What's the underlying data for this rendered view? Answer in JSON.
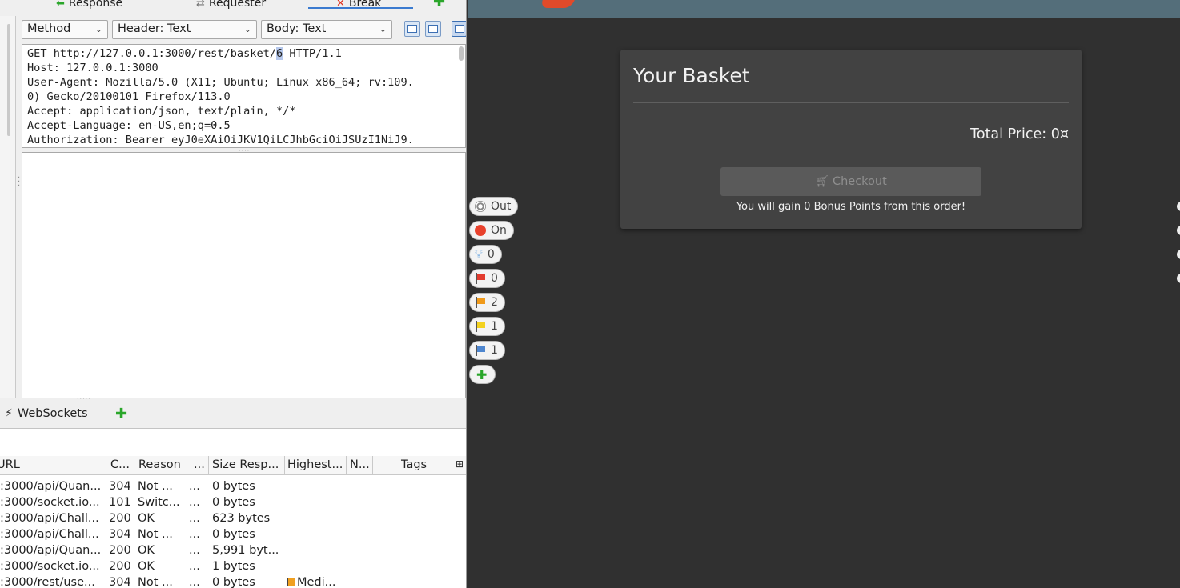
{
  "zap": {
    "tabs": [
      {
        "label": "Response",
        "icon": "arrow-left-icon"
      },
      {
        "label": "Requester",
        "icon": "requester-icon"
      },
      {
        "label": "Break",
        "icon": "break-icon"
      }
    ],
    "combos": {
      "method": "Method",
      "header": "Header: Text",
      "body": "Body: Text"
    },
    "request_lines": [
      "GET http://127.0.0.1:3000/rest/basket/",
      "6",
      " HTTP/1.1",
      "Host: 127.0.0.1:3000",
      "User-Agent: Mozilla/5.0 (X11; Ubuntu; Linux x86_64; rv:109.",
      "0) Gecko/20100101 Firefox/113.0",
      "Accept: application/json, text/plain, */*",
      "Accept-Language: en-US,en;q=0.5",
      "Authorization: Bearer eyJ0eXAiOiJKV1QiLCJhbGciOiJSUzI1NiJ9."
    ],
    "websockets_label": "WebSockets",
    "table": {
      "headers": [
        "URL",
        "C...",
        "Reason",
        "...",
        "Size Resp...",
        "Highest...",
        "N...",
        "Tags"
      ],
      "rows": [
        {
          "url": ":3000/api/Quan...",
          "code": "304",
          "reason": "Not ...",
          "rtt": "...",
          "size": "0 bytes",
          "alert": ""
        },
        {
          "url": ":3000/socket.io...",
          "code": "101",
          "reason": "Switc...",
          "rtt": "...",
          "size": "0 bytes",
          "alert": ""
        },
        {
          "url": ":3000/api/Chall...",
          "code": "200",
          "reason": "OK",
          "rtt": "...",
          "size": "623 bytes",
          "alert": ""
        },
        {
          "url": ":3000/api/Chall...",
          "code": "304",
          "reason": "Not ...",
          "rtt": "...",
          "size": "0 bytes",
          "alert": ""
        },
        {
          "url": ":3000/api/Quan...",
          "code": "200",
          "reason": "OK",
          "rtt": "...",
          "size": "5,991 byt...",
          "alert": ""
        },
        {
          "url": ":3000/socket.io...",
          "code": "200",
          "reason": "OK",
          "rtt": "...",
          "size": "1 bytes",
          "alert": ""
        },
        {
          "url": ":3000/rest/use...",
          "code": "304",
          "reason": "Not ...",
          "rtt": "...",
          "size": "0 bytes",
          "alert": "Medi..."
        }
      ]
    }
  },
  "hud": {
    "out_label": "Out",
    "on_label": "On",
    "alerts_info": "0",
    "alerts_high": "0",
    "alerts_medium": "2",
    "alerts_low": "1",
    "alerts_informational": "1"
  },
  "basket": {
    "title": "Your Basket",
    "total_label": "Total Price: 0¤",
    "checkout_label": "Checkout",
    "bonus_text": "You will gain 0 Bonus Points from this order!"
  },
  "colors": {
    "toolbar": "#546e7a",
    "page_bg": "#303030",
    "card_bg": "#424242",
    "zap_bg": "#efefef"
  }
}
